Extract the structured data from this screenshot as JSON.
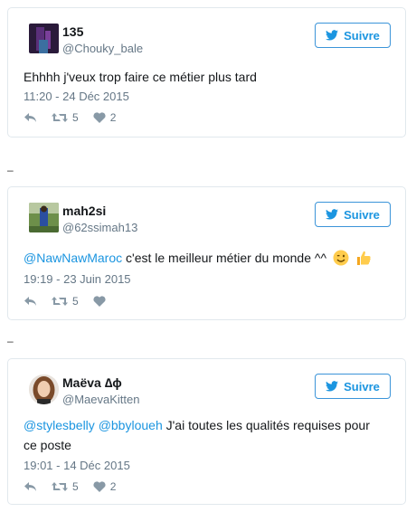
{
  "tweets": [
    {
      "name": "135",
      "handle": "@Chouky_bale",
      "follow_label": "Suivre",
      "text": "Ehhhh j'veux trop faire ce métier plus tard",
      "time": "11:20 - 24 Déc 2015",
      "retweets": "5",
      "likes": "2"
    },
    {
      "name": "mah2si",
      "handle": "@62ssimah13",
      "follow_label": "Suivre",
      "mention": "@NawNawMaroc",
      "text": " c'est le meilleur métier du monde ^^",
      "time": "19:19 - 23 Juin 2015",
      "retweets": "5",
      "likes": ""
    },
    {
      "name": "Maëva ∆ϕ",
      "handle": "@MaevaKitten",
      "follow_label": "Suivre",
      "mention1": "@stylesbelly",
      "mention2": "@bbyloueh",
      "text_line1": " J'ai toutes les qualités requises pour",
      "text_line2": "ce poste",
      "time": "19:01 - 14 Déc 2015",
      "retweets": "5",
      "likes": "2"
    }
  ],
  "separator": "–",
  "colors": {
    "link": "#1b95e0",
    "muted": "#657786",
    "border": "#e1e8ed"
  },
  "icons": [
    "reply-icon",
    "retweet-icon",
    "heart-icon",
    "twitter-bird-icon",
    "winking-face-emoji",
    "thumbs-up-emoji"
  ]
}
